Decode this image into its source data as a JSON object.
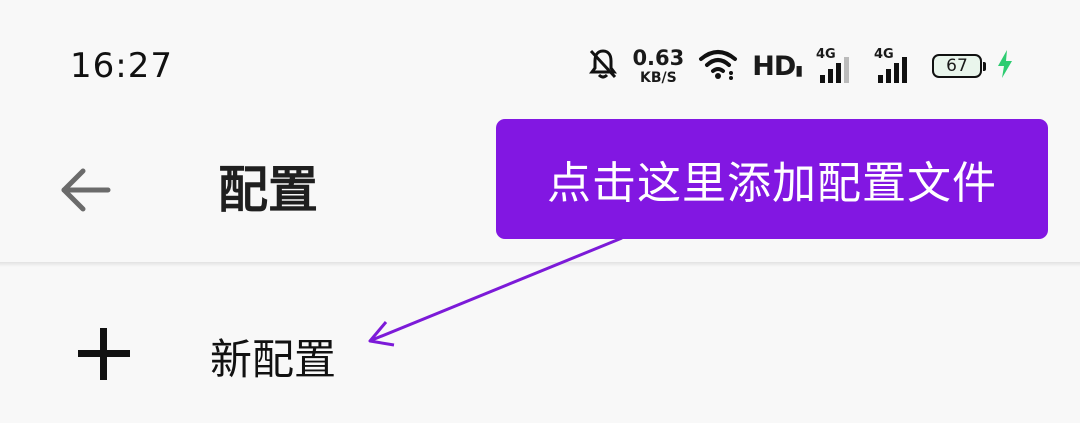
{
  "status_bar": {
    "time": "16:27",
    "net_speed_value": "0.63",
    "net_speed_unit": "KB/S",
    "hd_label": "HD",
    "sim1_type": "4G",
    "sim2_type": "4G",
    "battery_level": "67",
    "battery_color": "#2ecc71"
  },
  "app_bar": {
    "title": "配置"
  },
  "list": {
    "items": [
      {
        "label": "新配置",
        "icon": "plus-icon"
      }
    ]
  },
  "tooltip": {
    "text": "点击这里添加配置文件",
    "color": "#8217e2"
  }
}
